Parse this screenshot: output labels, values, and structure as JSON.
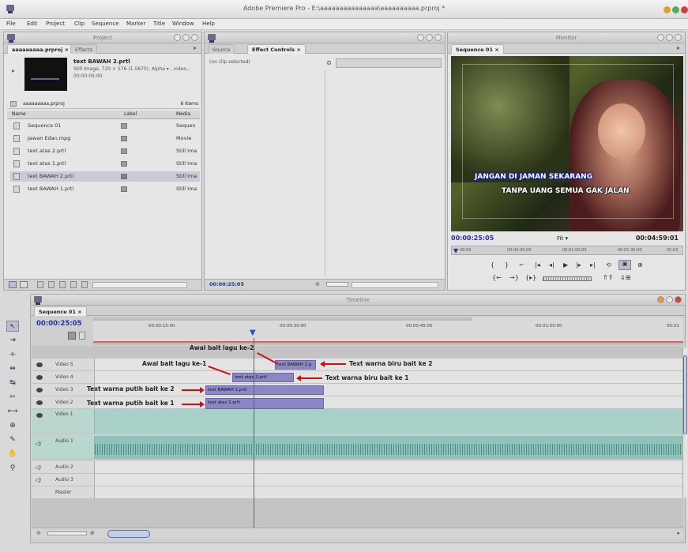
{
  "window": {
    "title": "Adobe Premiere Pro - E:\\aaaaaaaaaaaaaaa\\aaaaaaaaaa.prproj *"
  },
  "menu": [
    "File",
    "Edit",
    "Project",
    "Clip",
    "Sequence",
    "Marker",
    "Title",
    "Window",
    "Help"
  ],
  "project": {
    "panel_title": "Project",
    "tabs": [
      "aaaaaaaaa.prproj ×",
      "Effects"
    ],
    "preview_name": "text BAWAH 2.prtl",
    "preview_info": "Still Image, 720 × 576 (1.0670), Alpha  ▾ , video...",
    "preview_duration": "00:00:05:00",
    "bin_path": "aaaaaaaaa.prproj",
    "item_count": "6 Items",
    "columns": [
      "Name",
      "Label",
      "Media"
    ],
    "items": [
      {
        "name": "Sequence 01",
        "media": "Sequen"
      },
      {
        "name": "Jawan Edan.mpg",
        "media": "Movie"
      },
      {
        "name": "text atas 2.prtl",
        "media": "Still Ima"
      },
      {
        "name": "text atas 1.prtl",
        "media": "Still Ima"
      },
      {
        "name": "text BAWAH 2.prtl",
        "media": "Still Ima"
      },
      {
        "name": "text BAWAH 1.prtl",
        "media": "Still Ima"
      }
    ]
  },
  "source": {
    "tabs": [
      "Source",
      "Effect Controls ×"
    ],
    "no_clip": "(no clip selected)",
    "timecode": "00:00:25:05"
  },
  "monitor": {
    "panel_title": "Monitor",
    "tab": "Sequence 01 ×",
    "caption1": "JANGAN DI JAMAN SEKARANG",
    "caption2": "TANPA UANG SEMUA GAK JALAN",
    "timecode": "00:00:25:05",
    "fit": "Fit",
    "duration": "00:04:59:01",
    "ruler": [
      "00:00",
      "00:00:30:00",
      "00:01:00:00",
      "00:01:30:00",
      "00:02"
    ]
  },
  "timeline": {
    "panel_title": "Timeline",
    "tab": "Sequence 01 ×",
    "timecode": "00:00:25:05",
    "ruler": [
      "00:00:15:00",
      "00:00:30:00",
      "00:00:45:00",
      "00:01:00:00",
      "00:01"
    ],
    "tracks": [
      "Video 5",
      "Video 4",
      "Video 3",
      "Video 2",
      "Video 1",
      "Audio 1",
      "Audio 2",
      "Audio 3",
      "Master"
    ],
    "clips": {
      "v5": "text BAWAH 2.p",
      "v4": "text atas 2.prtl",
      "v3": "text BAWAH 1.prtl",
      "v2": "text atas 1.prtl"
    }
  },
  "annotations": {
    "a1": "Awal bait lagu ke-2",
    "a2": "Awal bait lagu ke-1",
    "a3": "Text warna biru bait ke 2",
    "a4": "Text warna biru bait ke 1",
    "a5": "Text warna putih bait ke 2",
    "a6": "Text warna putih bait ke 1"
  },
  "colors": {
    "accent": "#2233aa",
    "clip": "#8b87c4",
    "playhead": "#e03030",
    "video_track": "#a8d0c8"
  }
}
